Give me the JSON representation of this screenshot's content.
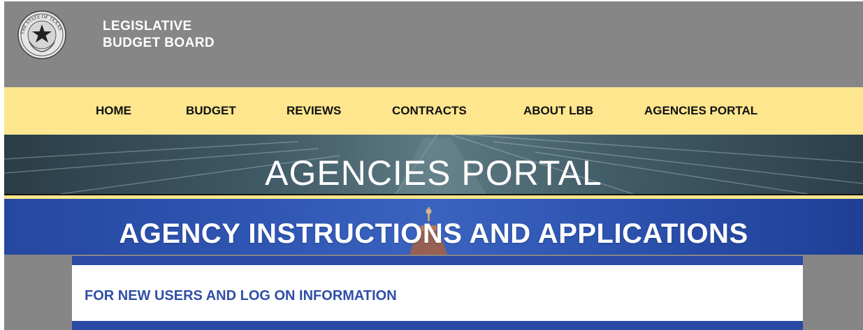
{
  "header": {
    "brand_line1": "LEGISLATIVE",
    "brand_line2": "BUDGET BOARD",
    "seal_icon": "state-of-texas-seal-icon",
    "seal_text": "THE STATE OF TEXAS"
  },
  "nav": {
    "items": [
      {
        "label": "HOME"
      },
      {
        "label": "BUDGET"
      },
      {
        "label": "REVIEWS"
      },
      {
        "label": "CONTRACTS"
      },
      {
        "label": "ABOUT LBB"
      },
      {
        "label": "AGENCIES PORTAL"
      }
    ]
  },
  "hero": {
    "title": "AGENCIES PORTAL"
  },
  "banner": {
    "title": "AGENCY INSTRUCTIONS AND APPLICATIONS"
  },
  "panel": {
    "heading": "FOR NEW USERS AND LOG ON INFORMATION"
  },
  "colors": {
    "header_gray": "#868686",
    "nav_yellow": "#fde68e",
    "banner_blue": "#2f56b3",
    "link_blue": "#2f4ea8"
  }
}
